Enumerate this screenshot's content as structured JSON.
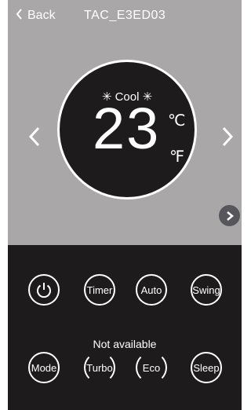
{
  "header": {
    "back_label": "Back",
    "back_icon": "chevron-left-icon",
    "device_name": "TAC_E3ED03"
  },
  "dial": {
    "mode_label": "Cool",
    "mode_icon": "snowflake-icon",
    "temperature": "23",
    "unit_celsius": "℃",
    "unit_fahrenheit": "℉"
  },
  "controls": {
    "power_icon": "power-icon",
    "timer_label": "Timer",
    "auto_label": "Auto",
    "swing_label": "Swing",
    "mode_label": "Mode",
    "turbo_label": "Turbo",
    "eco_label": "Eco",
    "sleep_label": "Sleep",
    "unavailable_note": "Not available"
  },
  "colors": {
    "top_panel": "#a9a7a8",
    "bottom_panel": "#1e1b1c",
    "dial": "#1e1b1c",
    "more_button": "#57565a"
  }
}
